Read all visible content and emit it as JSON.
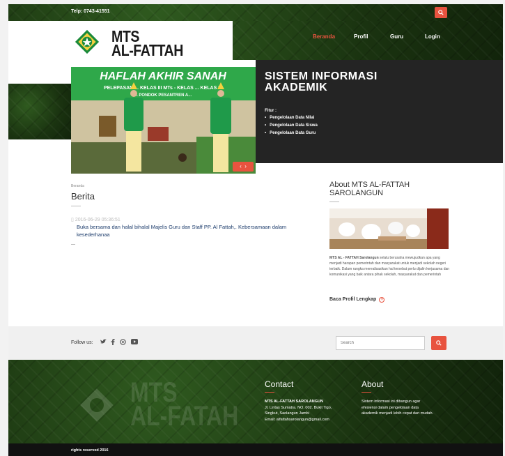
{
  "topbar": {
    "phone": "Telp: 0743-41551"
  },
  "logo": {
    "line1": "MTS",
    "line2": "AL-FATTAH"
  },
  "nav": {
    "items": [
      "Beranda",
      "Profil",
      "Guru",
      "Login"
    ]
  },
  "hero": {
    "title_line1": "SISTEM INFORMASI",
    "title_line2": "AKADEMIK",
    "features_label": "Fitur :",
    "features": [
      "Pengelolaan Data Nilai",
      "Pengelolaan Data Siswa",
      "Pengelolaan Data Guru"
    ],
    "slide_banner_line1": "HAFLAH AKHIR SANAH",
    "slide_banner_line2": "PELEPASAN ... KELAS III MTs - KELAS ... KELAS III",
    "slide_banner_line3": "... PONDOK PESANTREN A..."
  },
  "content": {
    "breadcrumb": "Beranda",
    "title": "Berita",
    "news": [
      {
        "date": "2016-06-29 05:36:51",
        "text": "Buka bersama dan halal bihalal Majelis Guru dan Staff PP. Al Fattah,. Kebersamaan dalam kesederhanaa"
      }
    ]
  },
  "about": {
    "title": "About MTS AL-FATTAH SAROLANGUN",
    "text_bold": "MTS AL - FATTAH Sarolangun",
    "text_rest": " selalu berusaha mewujudkan apa yang menjadi harapan pemerintah dan masyarakat untuk menjadi sekolah negeri terbaik. Dalam rangka merealisasikan hal tersebut perlu dijalin kerjasama dan komunikasi yang baik antara pihak sekolah, masyarakat dan pemerintah",
    "link": "Baca Profil Lengkap"
  },
  "follow": {
    "label": "Follow us:",
    "search_placeholder": "Search"
  },
  "footer": {
    "watermark_line1": "MTS",
    "watermark_line2": "AL-FATAH",
    "contact_title": "Contact",
    "contact_name": "MTS AL-FATTAH SAROLANGUN",
    "contact_lines": [
      "Jl. Lintas Sumatra. NO. 002. Bukit Tigo,",
      "Singkut, Saolangun Jambi",
      "Email: alfattahsarolangun@gmail.com"
    ],
    "about_title": "About",
    "about_lines": [
      "Sistem informasi ini dibangun agar",
      "efesiensi dalam pengelolaan data",
      "akademik menjadi lebih cepat dan mudah."
    ],
    "rights": "rights reserved 2016"
  },
  "colors": {
    "accent": "#e8533f",
    "dark": "#242424",
    "green": "#1e3a14",
    "link": "#1a3a6a"
  }
}
